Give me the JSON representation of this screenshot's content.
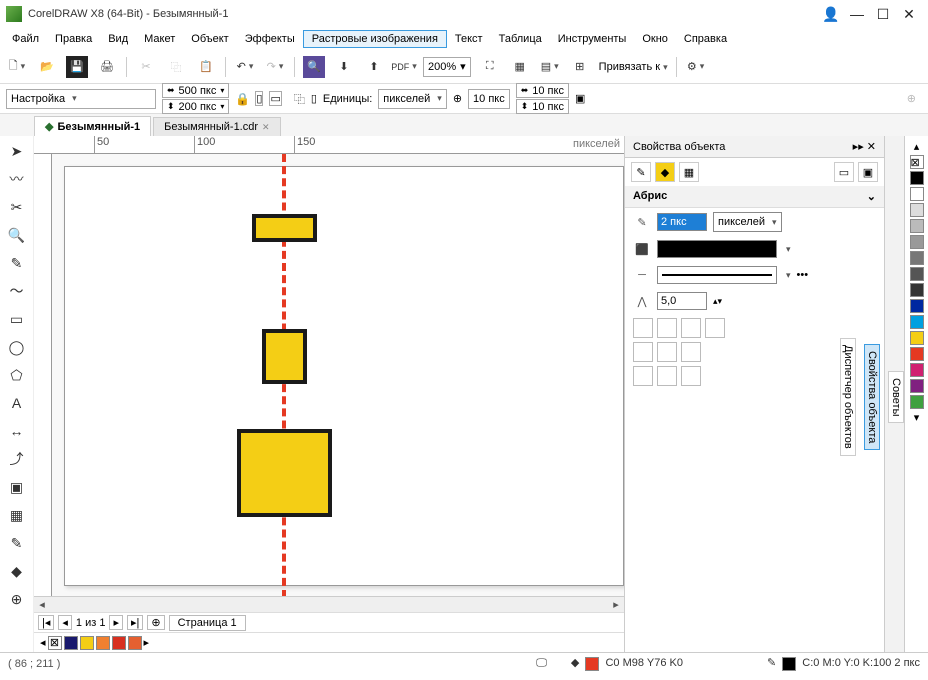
{
  "title": "CorelDRAW X8 (64-Bit) - Безымянный-1",
  "menu": {
    "file": "Файл",
    "edit": "Правка",
    "view": "Вид",
    "layout": "Макет",
    "object": "Объект",
    "effects": "Эффекты",
    "bitmap": "Растровые изображения",
    "text": "Текст",
    "table": "Таблица",
    "tools": "Инструменты",
    "window": "Окно",
    "help": "Справка"
  },
  "toolbar1": {
    "zoom": "200%",
    "snap": "Привязать к"
  },
  "properties": {
    "preset": "Настройка",
    "width": "500 пкс",
    "height": "200 пкс",
    "units_label": "Единицы:",
    "units": "пикселей",
    "nudge": "10 пкс",
    "dup_x": "10 пкс",
    "dup_y": "10 пкс"
  },
  "docs": {
    "tab1": "Безымянный-1",
    "tab2": "Безымянный-1.cdr"
  },
  "ruler": {
    "t50": "50",
    "t100": "100",
    "t150": "150",
    "unit": "пикселей"
  },
  "pages": {
    "nav": "1  из  1",
    "tab": "Страница 1"
  },
  "panel": {
    "title": "Свойства объекта",
    "section": "Абрис",
    "outline_width": "2 пкс",
    "outline_unit": "пикселей",
    "miter": "5,0"
  },
  "side": {
    "hints": "Советы",
    "props": "Свойства объекта",
    "objmgr": "Диспетчер объектов"
  },
  "status": {
    "coords": "( 86   ; 211   )",
    "fill": "C0 M98 Y76 K0",
    "outline": "C:0 M:0 Y:0 K:100  2 пкс"
  },
  "palette": [
    "#000000",
    "#1a1a6d",
    "#f4ce15",
    "#f08030",
    "#d83020",
    "#e56030",
    "#fff"
  ],
  "rpalette": [
    "none",
    "#000",
    "#fff",
    "#ddd",
    "#bbb",
    "#999",
    "#777",
    "#555",
    "#333",
    "#000",
    "#0028a0",
    "#00a0e0",
    "#f4ce15",
    "#e53922",
    "#d02070",
    "#802080",
    "#40a040",
    "#ffffff"
  ]
}
